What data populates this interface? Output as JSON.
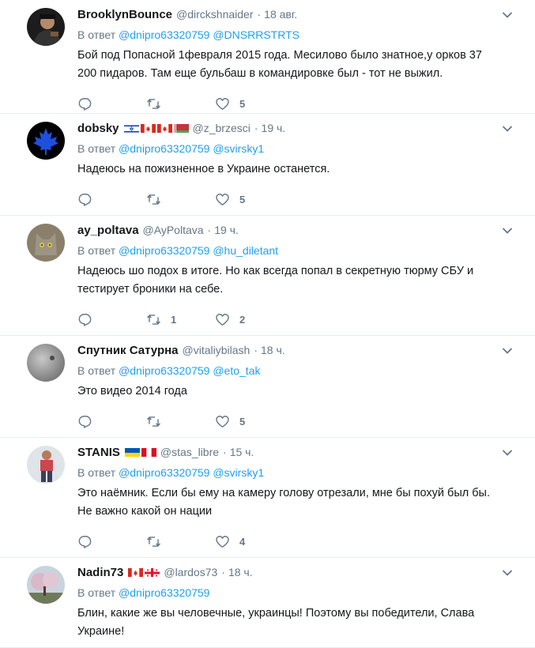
{
  "tweets": [
    {
      "name": "BrooklynBounce",
      "handle": "@dirckshnaider",
      "dot": "·",
      "time": "18 авг.",
      "reply_prefix": "В ответ",
      "mentions": [
        "@dnipro63320759",
        "@DNSRRSTRTS"
      ],
      "text_lines": [
        "Бой под Попасной 1февраля 2015 года. Месилово было знатное,у орков 37",
        "200 пидаров. Там еще бульбаш в командировке был - тот не выжил."
      ],
      "flags": [],
      "avatar": "dark-figure",
      "retweets": "",
      "likes": "5"
    },
    {
      "name": "dobsky",
      "handle": "@z_brzesci",
      "dot": "·",
      "time": "19 ч.",
      "reply_prefix": "В ответ",
      "mentions": [
        "@dnipro63320759",
        "@svirsky1"
      ],
      "text_lines": [
        "Надеюсь на пожизненное в Украине останется."
      ],
      "flags": [
        "israel",
        "canada",
        "canada",
        "belarus"
      ],
      "avatar": "maple-leaf",
      "retweets": "",
      "likes": "5"
    },
    {
      "name": "ay_poltava",
      "handle": "@AyPoltava",
      "dot": "·",
      "time": "19 ч.",
      "reply_prefix": "В ответ",
      "mentions": [
        "@dnipro63320759",
        "@hu_diletant"
      ],
      "text_lines": [
        "Надеюсь шо подох в итоге. Но как всегда попал в секретную тюрму СБУ и",
        "тестирует броники на себе."
      ],
      "flags": [],
      "avatar": "cat",
      "retweets": "1",
      "likes": "2"
    },
    {
      "name": "Спутник Сатурна",
      "handle": "@vitaliybilash",
      "dot": "·",
      "time": "18 ч.",
      "reply_prefix": "В ответ",
      "mentions": [
        "@dnipro63320759",
        "@eto_tak"
      ],
      "text_lines": [
        "Это видео 2014 года"
      ],
      "flags": [],
      "avatar": "moon",
      "retweets": "",
      "likes": "5"
    },
    {
      "name": "STANIS",
      "handle": "@stas_libre",
      "dot": "·",
      "time": "15 ч.",
      "reply_prefix": "В ответ",
      "mentions": [
        "@dnipro63320759",
        "@svirsky1"
      ],
      "text_lines": [
        "Это наёмник. Если бы ему на камеру голову отрезали, мне бы похуй был бы.",
        "Не важно какой он нации"
      ],
      "flags": [
        "ukraine",
        "peru"
      ],
      "avatar": "person",
      "retweets": "",
      "likes": "4"
    },
    {
      "name": "Nadin73",
      "handle": "@lardos73",
      "dot": "·",
      "time": "18 ч.",
      "reply_prefix": "В ответ",
      "mentions": [
        "@dnipro63320759"
      ],
      "text_lines": [
        "Блин, какие же вы человечные, украинцы! Поэтому вы победители, Слава",
        "Украине!"
      ],
      "flags": [
        "canada",
        "georgia"
      ],
      "avatar": "tree",
      "retweets": "",
      "likes": ""
    }
  ],
  "colors": {
    "link": "#1da1f2",
    "muted": "#657786",
    "divider": "#e6ecf0"
  },
  "icons": {
    "reply": "reply-icon",
    "retweet": "retweet-icon",
    "like": "heart-icon",
    "menu": "chevron-down-icon"
  }
}
